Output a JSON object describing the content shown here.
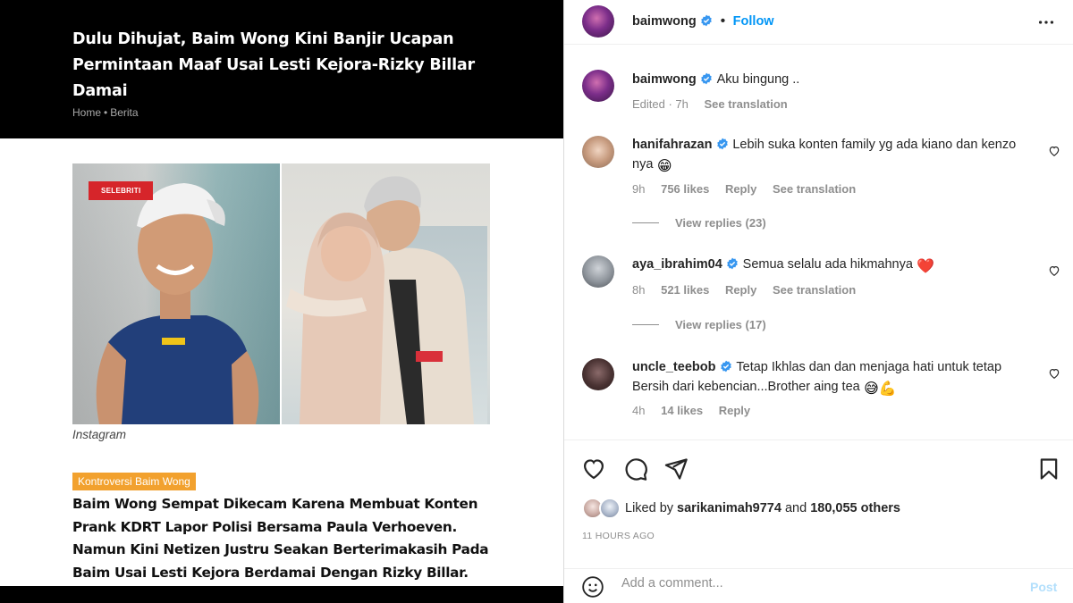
{
  "article": {
    "headline": "Dulu Dihujat, Baim Wong Kini Banjir Ucapan Permintaan Maaf Usai Lesti Kejora-Rizky Billar Damai",
    "breadcrumb": [
      "Home",
      "Berita"
    ],
    "photo_badge": "SELEBRITI",
    "photo_caption": "Instagram",
    "tag": "Kontroversi Baim Wong",
    "lede": "Baim Wong Sempat Dikecam Karena Membuat Konten Prank KDRT Lapor Polisi Bersama Paula Verhoeven. Namun Kini Netizen Justru Seakan Berterimakasih Pada Baim Usai Lesti Kejora Berdamai Dengan Rizky Billar."
  },
  "instagram": {
    "header": {
      "username": "baimwong",
      "follow_label": "Follow"
    },
    "caption": {
      "username": "baimwong",
      "text": "Aku bingung ..",
      "edited": "Edited · 7h",
      "see_translation": "See translation"
    },
    "comments": [
      {
        "username": "hanifahrazan",
        "text": "Lebih suka konten family yg ada kiano dan kenzo nya",
        "emoji": "😁",
        "time": "9h",
        "likes": "756 likes",
        "reply": "Reply",
        "see_translation": "See translation",
        "view_replies": "View replies (23)"
      },
      {
        "username": "aya_ibrahim04",
        "text": "Semua selalu ada hikmahnya",
        "emoji": "❤️",
        "time": "8h",
        "likes": "521 likes",
        "reply": "Reply",
        "see_translation": "See translation",
        "view_replies": "View replies (17)"
      },
      {
        "username": "uncle_teebob",
        "text": "Tetap Ikhlas dan dan menjaga hati untuk tetap Bersih dari kebencian...Brother aing tea",
        "emoji": "😅💪",
        "time": "4h",
        "likes": "14 likes",
        "reply": "Reply"
      }
    ],
    "liked_by_prefix": "Liked by",
    "liked_by_user": "sarikanimah9774",
    "liked_by_and": "and",
    "liked_by_others": "180,055 others",
    "time_ago": "11 HOURS AGO",
    "comment_placeholder": "Add a comment...",
    "post_label": "Post",
    "icons": [
      "more-icon",
      "verified-icon",
      "heart-icon",
      "comment-icon",
      "share-icon",
      "bookmark-icon",
      "emoji-icon"
    ],
    "colors": {
      "link": "#0095f6",
      "verified": "#3897f0",
      "post_disabled": "#b2dffc",
      "tag": "#f2a12e",
      "badge": "#d6252a"
    }
  }
}
